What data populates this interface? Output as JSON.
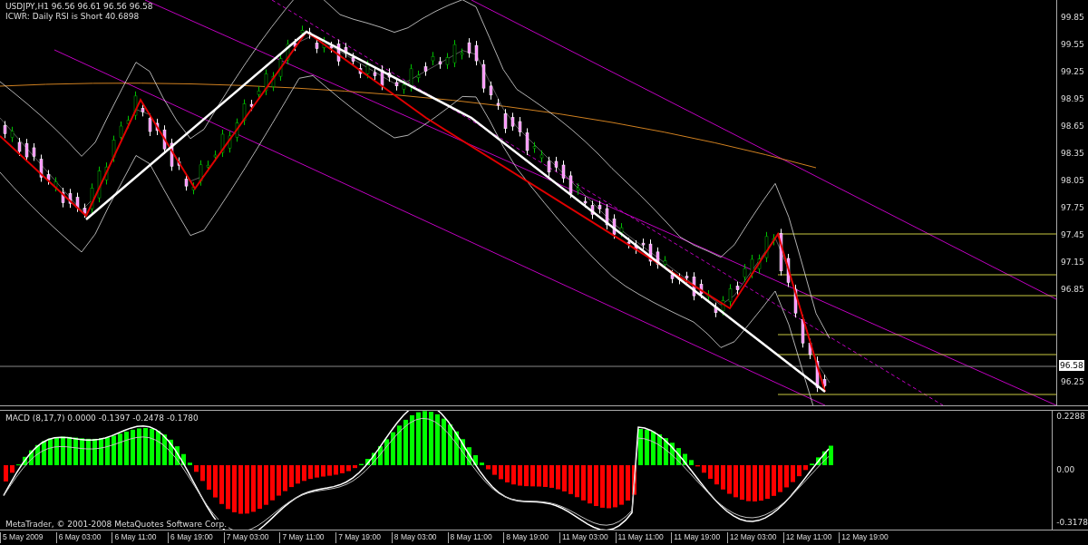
{
  "price_pane": {
    "symbol_line": "USDJPY,H1  96.56 96.61 96.56 96.58",
    "indicator_line": "ICWR: Daily RSI is Short 40.6898",
    "price_axis": [
      "99.85",
      "99.55",
      "99.25",
      "98.95",
      "98.65",
      "98.35",
      "98.05",
      "97.75",
      "97.45",
      "97.15",
      "96.85",
      "96.25"
    ],
    "current_price": "96.58"
  },
  "macd_pane": {
    "label": "MACD  (8,17,7) 0.0000 -0.1397 -0.2478 -0.1780",
    "axis": [
      "0.2288",
      "0.00",
      "-0.3178"
    ],
    "copyright": "MetaTrader, © 2001-2008 MetaQuotes Software Corp."
  },
  "time_axis": [
    "5 May 2009",
    "6 May 03:00",
    "6 May 11:00",
    "6 May 19:00",
    "7 May 03:00",
    "7 May 11:00",
    "7 May 19:00",
    "8 May 03:00",
    "8 May 11:00",
    "8 May 19:00",
    "11 May 03:00",
    "11 May 11:00",
    "11 May 19:00",
    "12 May 03:00",
    "12 May 11:00",
    "12 May 19:00"
  ]
}
